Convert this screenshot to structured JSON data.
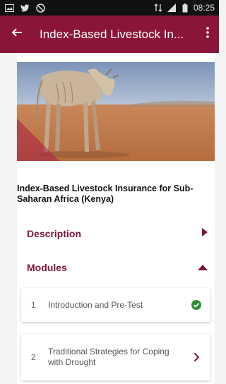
{
  "status_bar": {
    "time": "08:25",
    "left_icons": [
      "image-icon",
      "twitter-icon",
      "mute-icon"
    ],
    "right_icons": [
      "data-icon",
      "signal-icon",
      "battery-icon"
    ]
  },
  "app_bar": {
    "title": "Index-Based Livestock In...",
    "back_icon": "arrow-left-icon",
    "menu_icon": "more-vertical-icon",
    "background": "#8a1538"
  },
  "course": {
    "title": "Index-Based Livestock Insurance for Sub-Saharan Africa (Kenya)"
  },
  "sections": {
    "description": {
      "label": "Description",
      "icon": "caret-right-icon"
    },
    "modules": {
      "label": "Modules",
      "icon": "caret-up-icon"
    }
  },
  "modules": [
    {
      "number": "1",
      "title": "Introduction and Pre-Test",
      "status_icon": "check-circle-icon"
    },
    {
      "number": "2",
      "title": "Traditional Strategies for Coping with Drought",
      "status_icon": "chevron-right-icon"
    }
  ],
  "colors": {
    "accent": "#7d1535",
    "success": "#2e8b2e"
  }
}
